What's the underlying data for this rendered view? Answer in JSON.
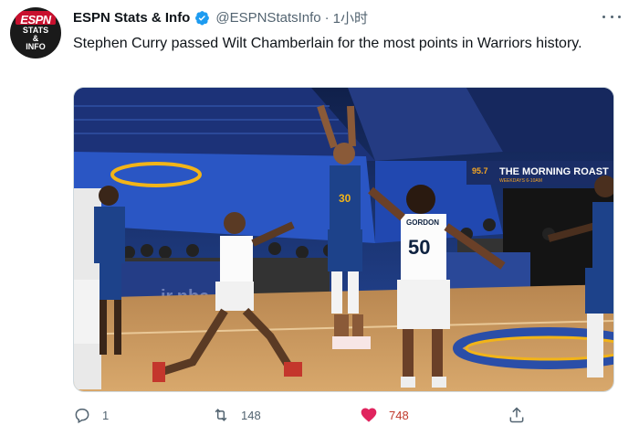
{
  "account": {
    "name": "ESPN Stats & Info",
    "handle": "@ESPNStatsInfo",
    "separator": "·",
    "time": "1小时",
    "avatar_logo_text": "ESPN",
    "avatar_sub_text": [
      "STATS",
      "&",
      "INFO"
    ],
    "verified": true
  },
  "tweet": {
    "text": "Stephen Curry passed Wilt Chamberlain for the most points in Warriors history."
  },
  "media": {
    "banner_text": "THE MORNING ROAST",
    "banner_sub": "WEEKDAYS 6-10AM",
    "banner_freq": "95.7",
    "jersey_curry": "30",
    "jersey_gordon": "50",
    "jersey_gordon_name": "GORDON",
    "court_logo": "jr.nba"
  },
  "actions": {
    "reply_count": "1",
    "retweet_count": "148",
    "like_count": "748"
  },
  "colors": {
    "verified": "#1d9bf0",
    "like": "#e0245e",
    "text_secondary": "#536471"
  }
}
